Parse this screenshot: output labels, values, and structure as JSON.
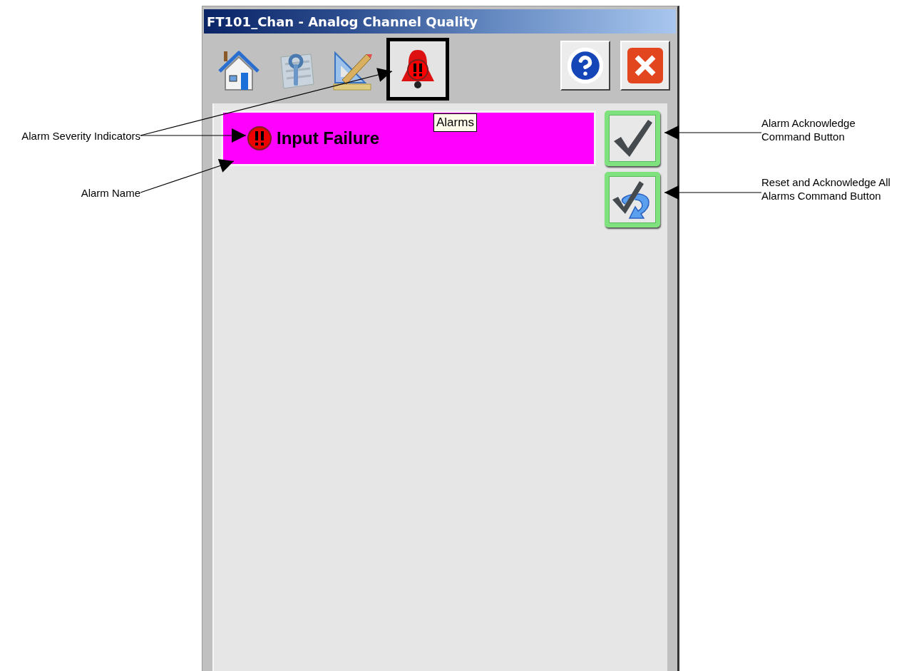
{
  "window": {
    "title": "FT101_Chan - Analog Channel Quality"
  },
  "toolbar": {
    "tabs": [
      {
        "kind": "home",
        "selected": false
      },
      {
        "kind": "maintenance",
        "selected": false
      },
      {
        "kind": "engineering",
        "selected": false
      },
      {
        "kind": "alarms",
        "selected": true
      }
    ],
    "tooltip": "Alarms",
    "buttons": [
      {
        "kind": "help"
      },
      {
        "kind": "close"
      }
    ]
  },
  "alarms": [
    {
      "name": "Input Failure",
      "color": "#ff00ff"
    }
  ],
  "commands": [
    {
      "kind": "acknowledge"
    },
    {
      "kind": "reset_acknowledge_all"
    }
  ],
  "callouts": [
    {
      "lines": [
        "Alarm Severity Indicators"
      ]
    },
    {
      "lines": [
        "Alarm Name"
      ]
    },
    {
      "lines": [
        "Alarm Acknowledge",
        "Command Button"
      ]
    },
    {
      "lines": [
        "Reset and Acknowledge All",
        "Alarms Command Button"
      ]
    }
  ]
}
